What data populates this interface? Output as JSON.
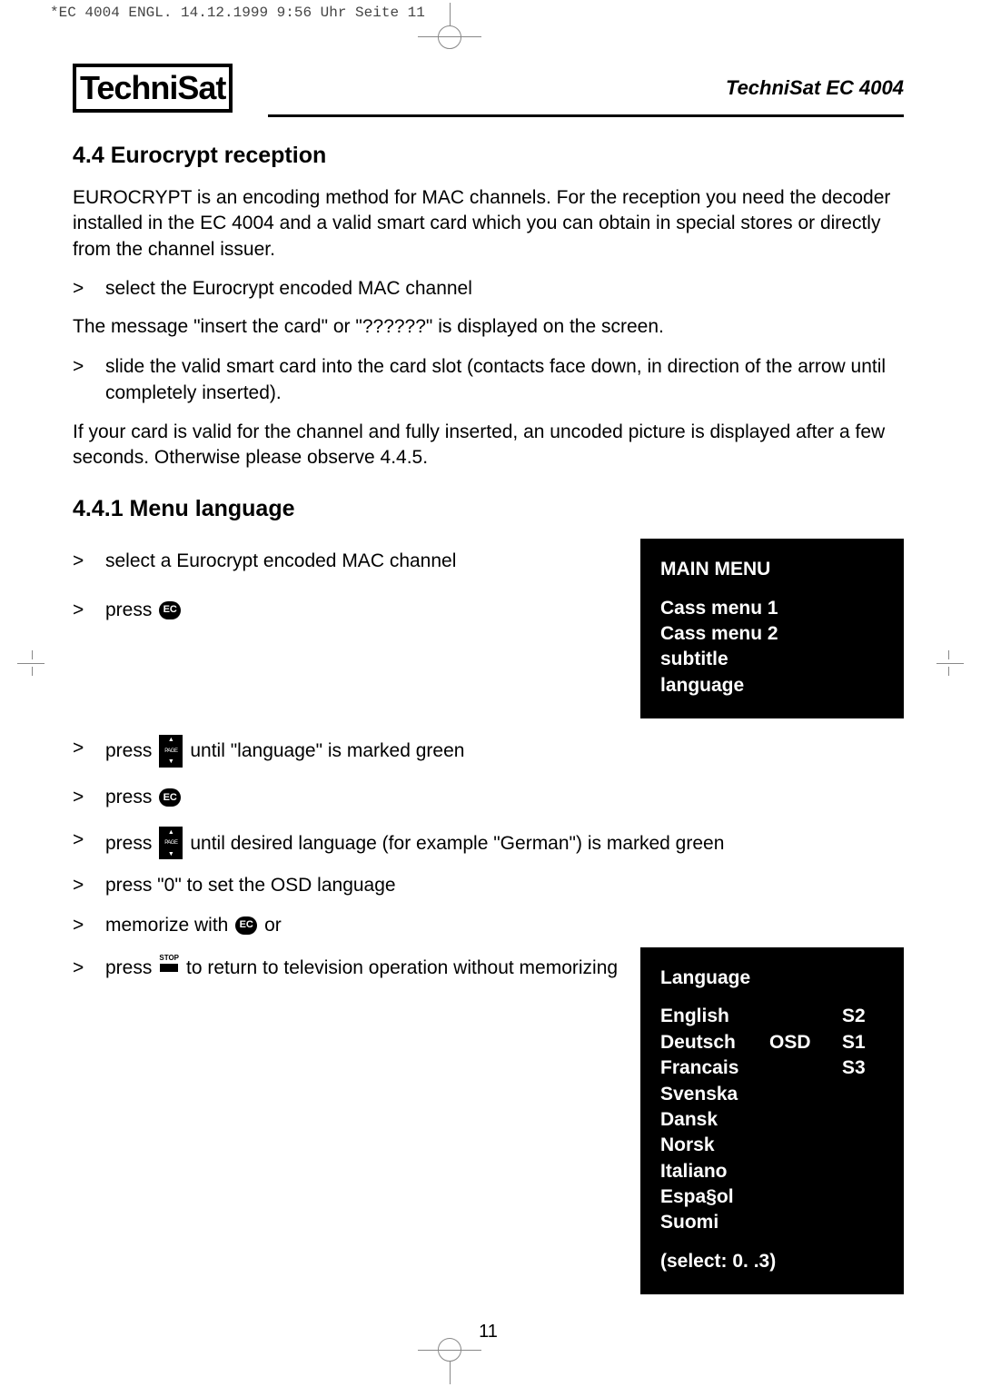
{
  "print_header": "*EC 4004 ENGL.  14.12.1999 9:56 Uhr  Seite 11",
  "brand": "TechniSat",
  "product": "TechniSat EC 4004",
  "section1": {
    "title": "4.4 Eurocrypt reception",
    "intro": "EUROCRYPT is an encoding method for MAC channels. For the reception you need the decoder installed in the EC 4004 and a valid smart card which you can obtain in special stores or directly from the channel issuer.",
    "step1": "select the Eurocrypt encoded MAC channel",
    "msg": "The message \"insert the card\" or \"??????\" is displayed on the screen.",
    "step2": "slide the valid smart card into the card slot (contacts face down, in direction of the arrow until completely inserted).",
    "closing": "If your card is valid for the channel and fully inserted, an uncoded picture is displayed after a few seconds. Otherwise please observe 4.4.5."
  },
  "section2": {
    "title": "4.4.1 Menu language",
    "step1": "select a Eurocrypt encoded MAC channel",
    "step2": "press",
    "step3_a": "press",
    "step3_b": "until \"language\" is marked green",
    "step4": "press",
    "step5_a": "press",
    "step5_b": "until desired language (for example \"German\") is marked green",
    "step6": "press \"0\" to set the OSD language",
    "step7_a": "memorize with",
    "step7_b": "or",
    "step8_a": "press",
    "step8_b": "to return to television operation without memorizing"
  },
  "osd_main": {
    "title": "MAIN MENU",
    "items": [
      "Cass menu 1",
      "Cass menu 2",
      "subtitle",
      "language"
    ]
  },
  "osd_lang": {
    "title": "Language",
    "rows": [
      {
        "name": "English",
        "osd": "",
        "slot": "S2"
      },
      {
        "name": "Deutsch",
        "osd": "OSD",
        "slot": "S1"
      },
      {
        "name": "Francais",
        "osd": "",
        "slot": "S3"
      },
      {
        "name": "Svenska",
        "osd": "",
        "slot": ""
      },
      {
        "name": "Dansk",
        "osd": "",
        "slot": ""
      },
      {
        "name": "Norsk",
        "osd": "",
        "slot": ""
      },
      {
        "name": "Italiano",
        "osd": "",
        "slot": ""
      },
      {
        "name": "Espa§ol",
        "osd": "",
        "slot": ""
      },
      {
        "name": "Suomi",
        "osd": "",
        "slot": ""
      }
    ],
    "footer": "(select:  0. .3)"
  },
  "icon_labels": {
    "ec": "EC",
    "page_up": "▲",
    "page_mid": "PAGE",
    "page_dn": "▼",
    "stop": "STOP"
  },
  "page_number": "11",
  "bullet": ">"
}
